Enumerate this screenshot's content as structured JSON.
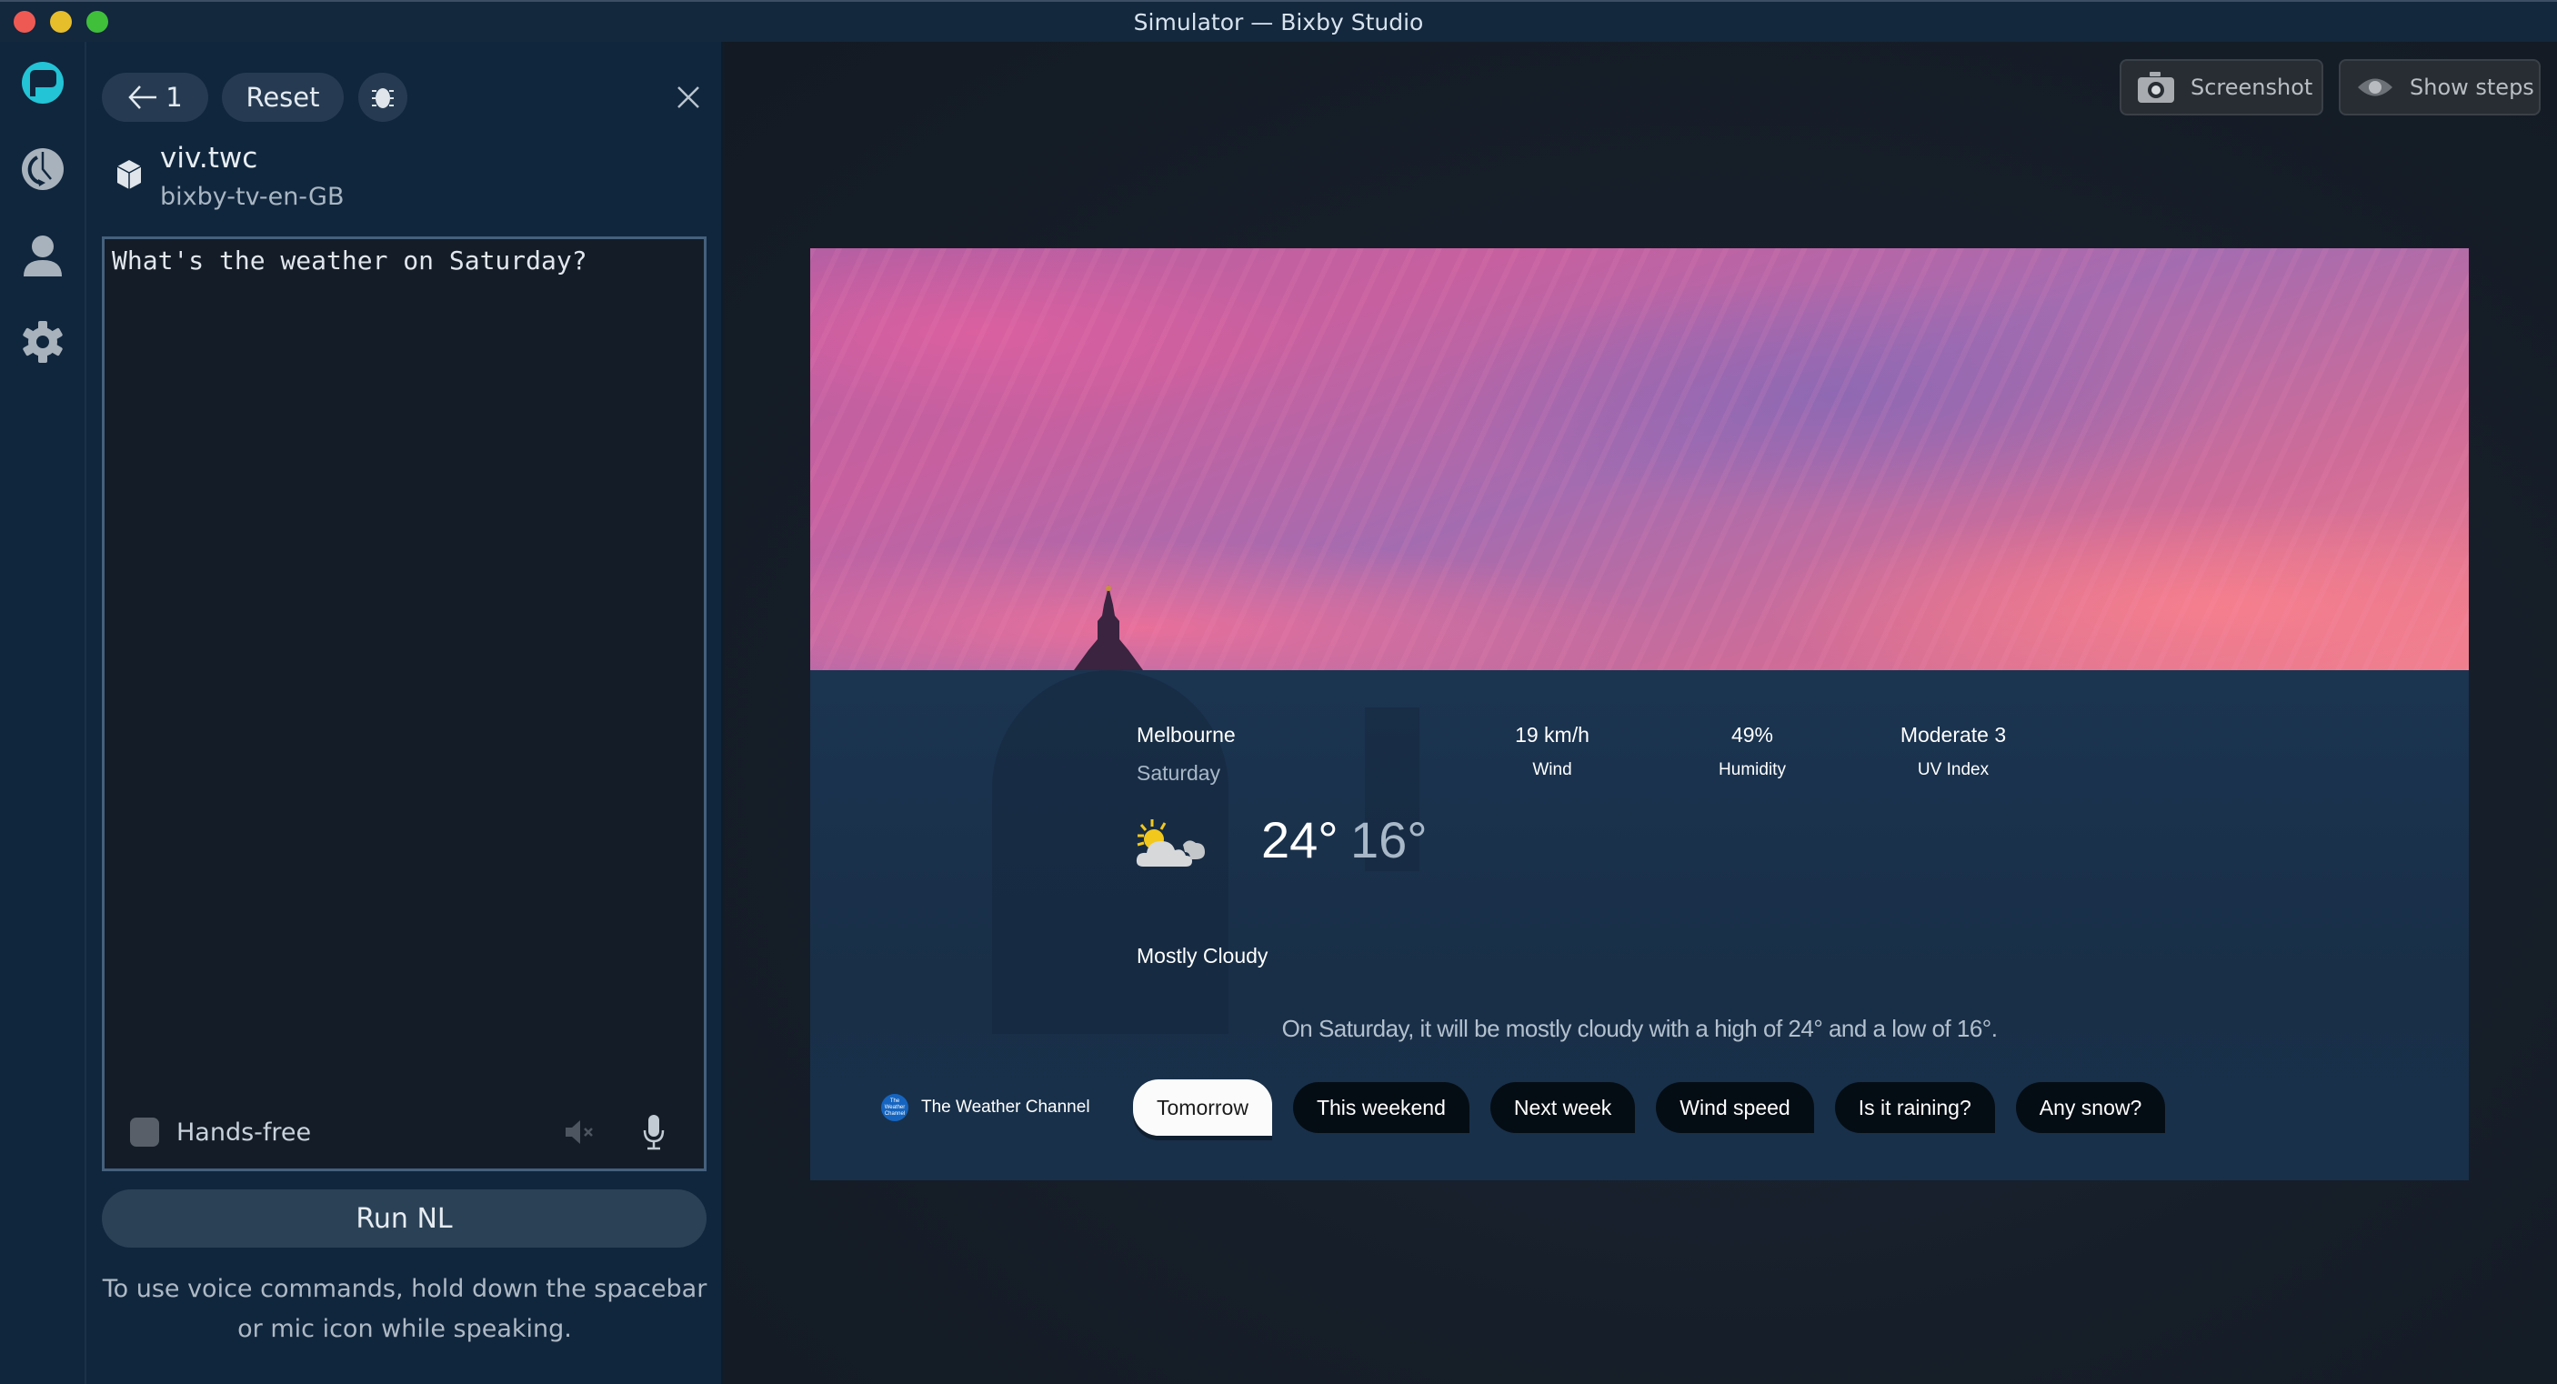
{
  "window": {
    "title": "Simulator — Bixby Studio"
  },
  "sidebar": {
    "items": [
      {
        "name": "bixby-logo-icon",
        "active": true
      },
      {
        "name": "history-icon"
      },
      {
        "name": "user-icon"
      },
      {
        "name": "settings-icon"
      }
    ]
  },
  "left_panel": {
    "back_label": "1",
    "reset_label": "Reset",
    "capsule": {
      "name": "viv.twc",
      "target": "bixby-tv-en-GB"
    },
    "nl_input": {
      "value": "What's the weather on Saturday?"
    },
    "hands_free_label": "Hands-free",
    "hands_free_checked": false,
    "run_label": "Run NL",
    "help_text": "To use voice commands, hold down the spacebar or mic icon while speaking."
  },
  "toolbar": {
    "screenshot_label": "Screenshot",
    "show_steps_label": "Show steps"
  },
  "weather": {
    "city": "Melbourne",
    "day": "Saturday",
    "high": "24°",
    "low": "16°",
    "condition": "Mostly Cloudy",
    "condition_icon": "partly-cloudy-icon",
    "stats": [
      {
        "value": "19 km/h",
        "label": "Wind"
      },
      {
        "value": "49%",
        "label": "Humidity"
      },
      {
        "value": "Moderate 3",
        "label": "UV Index"
      }
    ],
    "summary": "On Saturday, it will be mostly cloudy with a high of 24° and a low of 16°.",
    "source": {
      "logo_text": "The Weather Channel",
      "name": "The Weather Channel"
    },
    "follow_ups": [
      "Tomorrow",
      "This weekend",
      "Next week",
      "Wind speed",
      "Is it raining?",
      "Any snow?"
    ],
    "selected_follow_up": "Tomorrow"
  },
  "colors": {
    "bixby_accent": "#22c4d6",
    "panel_bg": "#10263d",
    "twc_blue": "#1565c0"
  }
}
